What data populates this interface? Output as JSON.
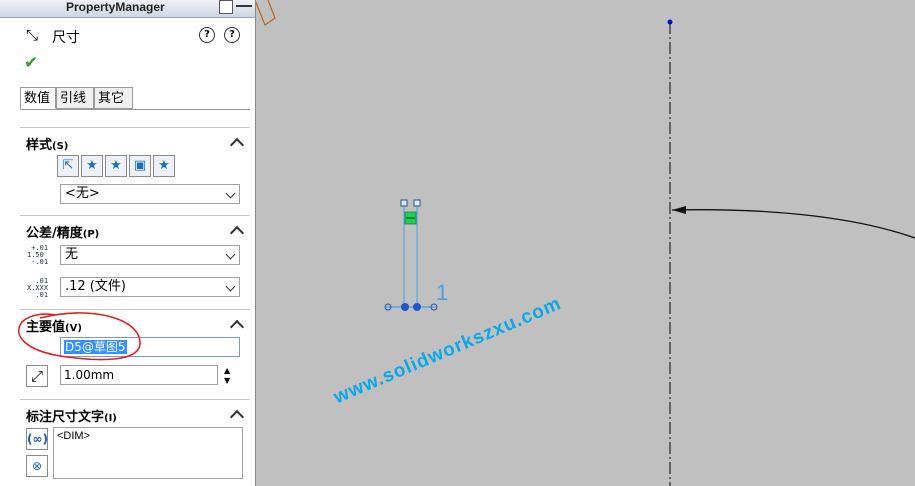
{
  "panel": {
    "header_title": "PropertyManager",
    "feature_title": "尺寸",
    "help_label": "?",
    "tabs": [
      "数值",
      "引线",
      "其它"
    ],
    "style_group": {
      "title": "样式",
      "key": "(S)",
      "selected": "<无>"
    },
    "tolerance_group": {
      "title": "公差/精度",
      "key": "(P)",
      "tolerance_value": "无",
      "precision_value": ".12 (文件)"
    },
    "primary_value_group": {
      "title": "主要值",
      "key": "(V)",
      "name_value": "D5@草图5",
      "dimension_value": "1.00mm"
    },
    "dim_text_group": {
      "title": "标注尺寸文字",
      "key": "(I)",
      "text_value": "<DIM>"
    }
  },
  "canvas": {
    "dimension_digit": "1",
    "watermark": "www.solidworkszxu.com"
  },
  "colors": {
    "canvas_bg": "#c0c0c0",
    "dimension_blue": "#4a9fe0",
    "annotation_red": "#e02020",
    "watermark": "#0aa8e8",
    "ok_green": "#2ca02c"
  }
}
